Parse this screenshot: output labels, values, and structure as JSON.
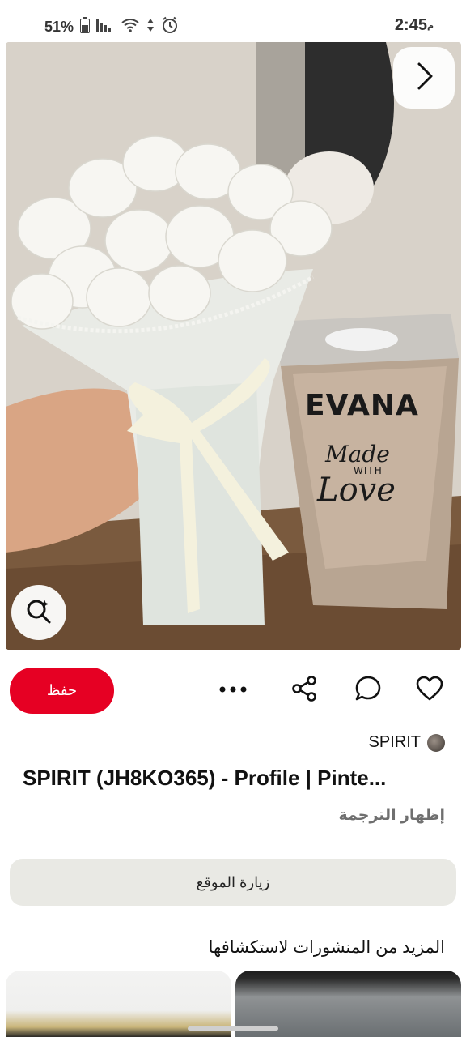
{
  "status_bar": {
    "time": "2:45",
    "ampm": "م",
    "battery": "51%"
  },
  "pin": {
    "image_text": {
      "brand": "EVANA",
      "line1": "Made",
      "line2": "WITH",
      "line3": "Love"
    }
  },
  "actions": {
    "save_label": "حفظ",
    "more_label": "•••"
  },
  "creator": {
    "name": "SPIRIT"
  },
  "title": "SPIRIT (JH8KO365) - Profile | Pinte...",
  "translate_label": "إظهار الترجمة",
  "visit_label": "زيارة الموقع",
  "more_heading": "المزيد من المنشورات لاستكشافها",
  "colors": {
    "accent": "#e60023",
    "secondary_button": "#e9e9e4"
  },
  "icons": [
    "chevron-right-icon",
    "visual-search-icon",
    "share-icon",
    "comment-icon",
    "heart-icon",
    "more-icon"
  ]
}
